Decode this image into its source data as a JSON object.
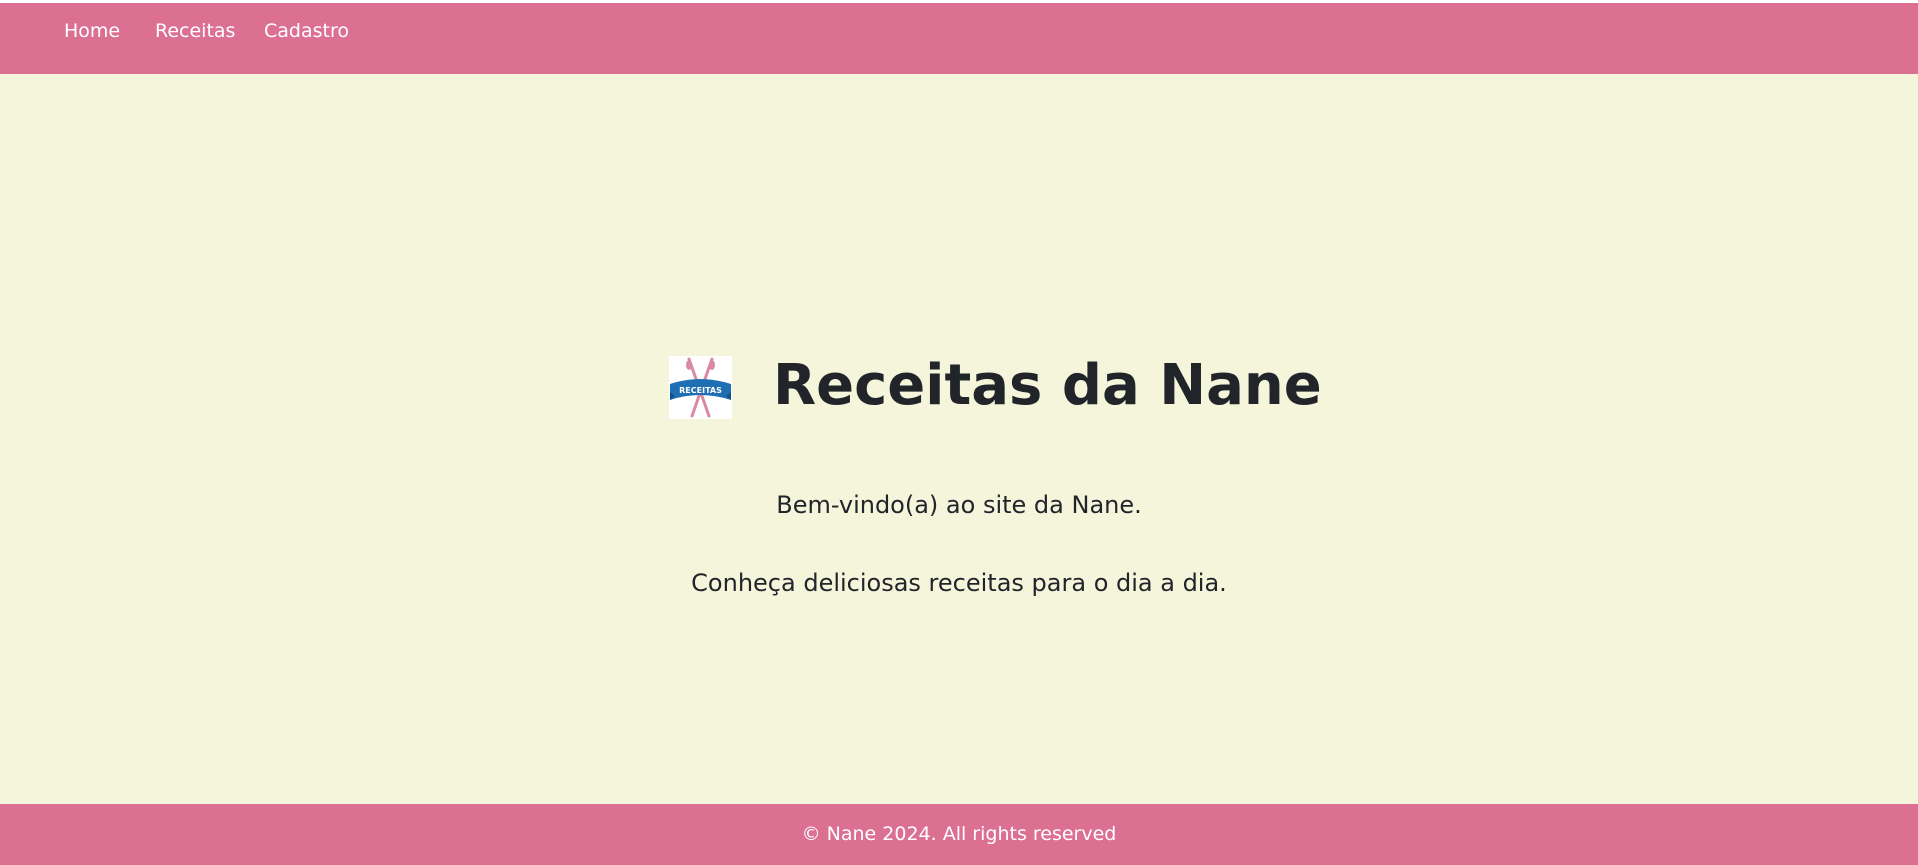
{
  "nav": {
    "items": [
      {
        "label": "Home"
      },
      {
        "label": "Receitas"
      },
      {
        "label": "Cadastro"
      }
    ]
  },
  "main": {
    "logo": {
      "icon": "recipes-banner-logo",
      "text": "RECEITAS"
    },
    "title": "Receitas da Nane",
    "welcome": "Bem-vindo(a) ao site da Nane.",
    "subtitle": "Conheça deliciosas receitas para o dia a dia."
  },
  "footer": {
    "text": "© Nane 2024. All rights reserved"
  },
  "colors": {
    "navbar": "#db7093",
    "background": "#f5f5dc",
    "text": "#212529",
    "nav_text": "#ffffff",
    "logo_banner": "#1f6fb5",
    "logo_utensils": "#d98aa0"
  }
}
